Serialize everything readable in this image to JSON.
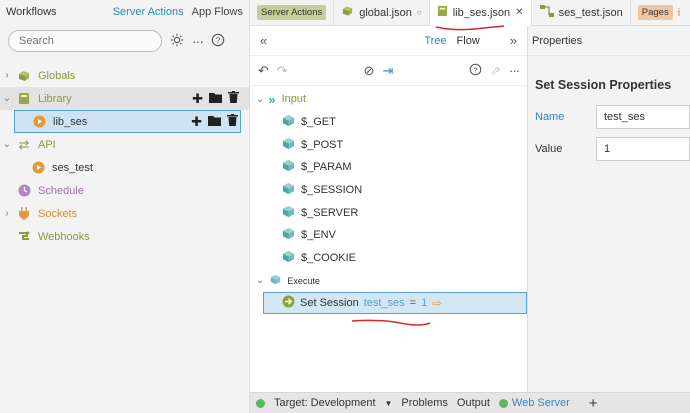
{
  "sidebar": {
    "title": "Workflows",
    "tabs": [
      "Server Actions",
      "App Flows"
    ],
    "search_placeholder": "Search",
    "items": [
      {
        "label": "Globals"
      },
      {
        "label": "Library"
      },
      {
        "label": "lib_ses"
      },
      {
        "label": "API"
      },
      {
        "label": "ses_test"
      },
      {
        "label": "Schedule"
      },
      {
        "label": "Sockets"
      },
      {
        "label": "Webhooks"
      }
    ]
  },
  "tabs": {
    "server_actions": "Server Actions",
    "global": "global.json",
    "lib_ses": "lib_ses.json",
    "ses_test": "ses_test.json",
    "pages": "Pages",
    "truncated": "i"
  },
  "editor": {
    "modes": [
      "Tree",
      "Flow"
    ],
    "input_label": "Input",
    "inputs": [
      "$_GET",
      "$_POST",
      "$_PARAM",
      "$_SESSION",
      "$_SERVER",
      "$_ENV",
      "$_COOKIE"
    ],
    "execute_label": "Execute",
    "step": {
      "action": "Set Session",
      "var": "test_ses",
      "eq": "=",
      "value": "1"
    }
  },
  "properties": {
    "header": "Properties",
    "section_title": "Set Session Properties",
    "name_label": "Name",
    "name_value": "test_ses",
    "value_label": "Value",
    "value_value": "1"
  },
  "status": {
    "target": "Target: Development",
    "problems": "Problems",
    "output": "Output",
    "web_server": "Web Server",
    "add": "+"
  }
}
